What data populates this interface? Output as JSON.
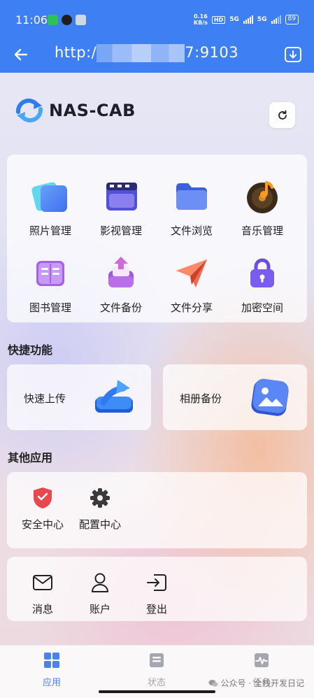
{
  "status_bar": {
    "time": "11:06",
    "net_speed_value": "0.16",
    "net_speed_unit": "KB/s",
    "hd_badge": "HD",
    "sim1": "5G",
    "sim2": "5G",
    "battery": "89"
  },
  "header": {
    "url_prefix": "http:/",
    "url_suffix": "7:9103"
  },
  "brand": {
    "name": "NAS-CAB"
  },
  "apps": [
    {
      "label": "照片管理",
      "icon": "photos-icon"
    },
    {
      "label": "影视管理",
      "icon": "video-icon"
    },
    {
      "label": "文件浏览",
      "icon": "folder-icon"
    },
    {
      "label": "音乐管理",
      "icon": "music-icon"
    },
    {
      "label": "图书管理",
      "icon": "book-icon"
    },
    {
      "label": "文件备份",
      "icon": "backup-icon"
    },
    {
      "label": "文件分享",
      "icon": "share-icon"
    },
    {
      "label": "加密空间",
      "icon": "lock-icon"
    }
  ],
  "quick": {
    "title": "快捷功能",
    "items": [
      {
        "label": "快速上传",
        "icon": "upload-icon"
      },
      {
        "label": "相册备份",
        "icon": "album-icon"
      }
    ]
  },
  "other": {
    "title": "其他应用",
    "items": [
      {
        "label": "安全中心",
        "icon": "shield-icon"
      },
      {
        "label": "配置中心",
        "icon": "gear-icon"
      }
    ]
  },
  "account": {
    "items": [
      {
        "label": "消息",
        "icon": "mail-icon"
      },
      {
        "label": "账户",
        "icon": "user-icon"
      },
      {
        "label": "登出",
        "icon": "logout-icon"
      }
    ]
  },
  "bottom_nav": [
    {
      "label": "应用",
      "icon": "grid-icon",
      "active": true
    },
    {
      "label": "状态",
      "icon": "status-icon",
      "active": false
    },
    {
      "label": "任务",
      "icon": "tasks-icon",
      "active": false
    }
  ],
  "watermark": "公众号 · 全栈开发日记",
  "colors": {
    "primary": "#3e7ff3",
    "nav_active": "#4a82ef"
  }
}
